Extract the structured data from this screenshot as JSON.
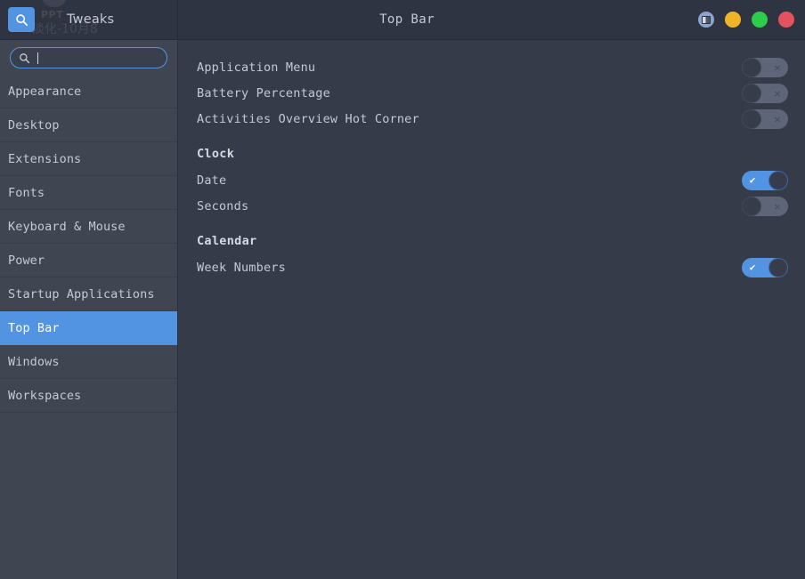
{
  "window": {
    "app_title": "Tweaks",
    "page_title": "Top Bar",
    "ghost_text_1": "PPT",
    "ghost_text_2": "淡化-10月8",
    "controls": [
      {
        "name": "sidebar-toggle-button",
        "color": "#8da3cf"
      },
      {
        "name": "minimize-button",
        "color": "#f0b429"
      },
      {
        "name": "maximize-button",
        "color": "#2ecc4c"
      },
      {
        "name": "close-button",
        "color": "#e4525e"
      }
    ]
  },
  "search": {
    "toggle_icon": "search-icon",
    "value": "",
    "placeholder": ""
  },
  "sidebar": {
    "items": [
      {
        "label": "Appearance",
        "selected": false
      },
      {
        "label": "Desktop",
        "selected": false
      },
      {
        "label": "Extensions",
        "selected": false
      },
      {
        "label": "Fonts",
        "selected": false
      },
      {
        "label": "Keyboard & Mouse",
        "selected": false
      },
      {
        "label": "Power",
        "selected": false
      },
      {
        "label": "Startup Applications",
        "selected": false
      },
      {
        "label": "Top Bar",
        "selected": true
      },
      {
        "label": "Windows",
        "selected": false
      },
      {
        "label": "Workspaces",
        "selected": false
      }
    ]
  },
  "content": {
    "top_rows": [
      {
        "label": "Application Menu",
        "state": "off"
      },
      {
        "label": "Battery Percentage",
        "state": "off"
      },
      {
        "label": "Activities Overview Hot Corner",
        "state": "off"
      }
    ],
    "sections": [
      {
        "title": "Clock",
        "rows": [
          {
            "label": "Date",
            "state": "on"
          },
          {
            "label": "Seconds",
            "state": "off"
          }
        ]
      },
      {
        "title": "Calendar",
        "rows": [
          {
            "label": "Week Numbers",
            "state": "on"
          }
        ]
      }
    ]
  },
  "glyphs": {
    "switch_on": "✔",
    "switch_off": "✕"
  },
  "colors": {
    "accent": "#5294e2",
    "sidebar_bg": "#404552",
    "content_bg": "#363b4a",
    "titlebar_bg": "#2f3442",
    "switch_off_track": "#5e6579",
    "text": "#c3c9d6"
  }
}
